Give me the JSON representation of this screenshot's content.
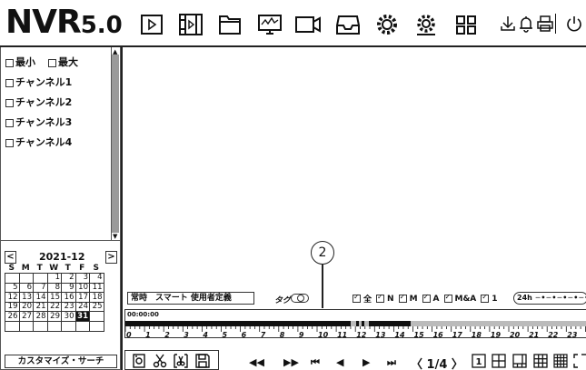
{
  "app": {
    "logo_main": "NVR",
    "logo_version": "5.0"
  },
  "toolbar": {
    "icons": [
      "play-icon",
      "filmstrip-icon",
      "folder-icon",
      "monitor-chart-icon",
      "camera-icon",
      "inbox-icon",
      "gear-icon",
      "advanced-gear-icon",
      "grid-icon"
    ],
    "right_icons": [
      "download-icon",
      "bell-icon",
      "printer-icon",
      "power-icon"
    ]
  },
  "channels": {
    "min_label": "最小",
    "max_label": "最大",
    "items": [
      "チャンネル1",
      "チャンネル2",
      "チャンネル3",
      "チャンネル4"
    ]
  },
  "calendar": {
    "title": "2021-12",
    "prev": "<",
    "next": ">",
    "weekdays": [
      "S",
      "M",
      "T",
      "W",
      "T",
      "F",
      "S"
    ],
    "weeks": [
      [
        "",
        "",
        "",
        "1",
        "2",
        "3",
        "4"
      ],
      [
        "5",
        "6",
        "7",
        "8",
        "9",
        "10",
        "11"
      ],
      [
        "12",
        "13",
        "14",
        "15",
        "16",
        "17",
        "18"
      ],
      [
        "19",
        "20",
        "21",
        "22",
        "23",
        "24",
        "25"
      ],
      [
        "26",
        "27",
        "28",
        "29",
        "30",
        "31",
        ""
      ],
      [
        "",
        "",
        "",
        "",
        "",
        "",
        ""
      ]
    ],
    "selected": "31"
  },
  "custom_search_label": "カスタマイズ・サーチ",
  "callout": "2",
  "mode_bar": {
    "label": "常時　スマート  使用者定義"
  },
  "tag_label": "タグ",
  "filters": {
    "all": "全",
    "n": "N",
    "m": "M",
    "a": "A",
    "ma": "M&A",
    "one": "1"
  },
  "hours_label": "24h",
  "timeline": {
    "start_time": "00:00:00",
    "hour_labels": [
      "0",
      "1",
      "2",
      "3",
      "4",
      "5",
      "6",
      "7",
      "8",
      "9",
      "10",
      "11",
      "12",
      "13",
      "14",
      "15",
      "16",
      "17",
      "18",
      "19",
      "20",
      "21",
      "22",
      "23",
      "2"
    ]
  },
  "tools": [
    "snapshot-icon",
    "scissors-icon",
    "clip-icon",
    "save-icon"
  ],
  "playback": {
    "rewind": "◀◀",
    "forward": "▶▶",
    "prev_frame": "⏮",
    "reverse": "◀",
    "play": "▶",
    "next_frame": "⏭"
  },
  "page": {
    "prev": "〈",
    "value": "1/4",
    "next": "〉"
  },
  "layouts": [
    "layout-1-icon",
    "layout-4-icon",
    "layout-6-icon",
    "layout-9-icon",
    "layout-16-icon",
    "fullscreen-icon"
  ]
}
